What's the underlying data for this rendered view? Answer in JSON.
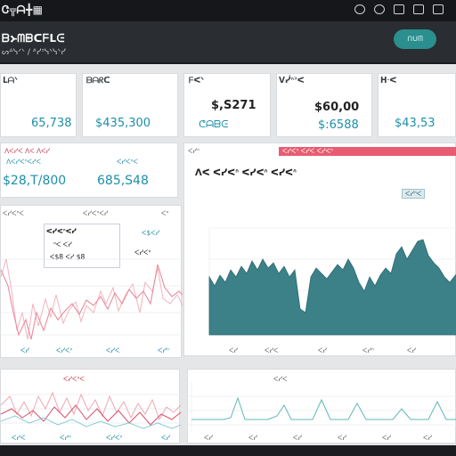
{
  "app": {
    "title": "Ꮳ╦ᗩ╋▦"
  },
  "header": {
    "title": "ᗷ᚛ᗰᗸᑕᖴᒪᕮ",
    "breadcrumb": "ᔕᐞᓭᐟᐠ / ᐥᓯᐣᓭᐠᓭᐠᓯ",
    "action_label": "ᑎᑌᗰ"
  },
  "kpis": [
    {
      "label": "ᒪᗩᐠ",
      "value": "65,738"
    },
    {
      "label": "ᗷᗩᖇᑕ",
      "value": "$435,300"
    },
    {
      "label": "ᖴᐸᐠ",
      "value": "$,S271",
      "sub": "ᕦᗩᗷᕮ"
    },
    {
      "label": "ᐯᓰᐢᐣᐸ",
      "value": "$60,00",
      "sub": "$:6588"
    },
    {
      "label": "ᕼᐧᐸ",
      "value": "$43,53"
    }
  ],
  "stats": {
    "header": "ᐱᐸᓯᐸ ᐱᐸ ᐱᐸᓯ",
    "row1_left": "ᐱᐸᓯᐸᐢᐸᓯᐸ",
    "row1_right": "ᐸᓯᐸᐢᐸ",
    "left_value": "$28,T/800",
    "right_value": "685,S48"
  },
  "left_chart": {
    "tab1": "ᐸᓯᐸᐢᐸ",
    "tab2": "ᐸᓯᐸᐢᐸᓯ",
    "tab3": "ᐸᐢ",
    "tooltip": [
      "ᐸᓯᐸᐢᐸᓯ",
      "ᐢᐸ ᐸᓯ",
      "ᐸ$8 ᐸᓯ $8"
    ],
    "legend_right": [
      "ᐸ$ᐸᓯ",
      "ᐸᓯᐸᐢ"
    ],
    "x_labels": [
      "ᐸᓯ",
      "ᐸᓯᐸᐢ",
      "ᐸᓯᐸ",
      "ᐸᓯᐢ"
    ]
  },
  "main_chart": {
    "title": "ᐱᐸ ᐸᓯᐸᐢ ᐸᓯᐸᐢ ᐸᓯᐸᐢ",
    "badge": "ᐸᓯᐢ",
    "filter": "ᐸᓯᐢᐸ",
    "red_tag": "ᐸᓯᐸᐢ ᐸᓯᐸ ᐸᓯᐸᐢ",
    "x_labels": [
      "ᐸᓯ",
      "ᐸᓯᐸ",
      "ᐸᓯ",
      "ᐸᓯᐢ",
      "ᐸᓯ"
    ]
  },
  "bottom_left": {
    "header": "ᐸᓯᐸᐢᐸ",
    "x_labels": [
      "ᐸᓯᐸ",
      "ᐸᓯᐢ",
      "ᐸᓯᐸᐢ",
      "ᐸᓯ"
    ]
  },
  "bottom_right": {
    "header": "ᐸᓯᐸ",
    "x_labels": [
      "ᐸᓯ",
      "ᐸᓯ",
      "ᐸᓯ",
      "ᐸᓯ",
      "ᐸᓯ",
      "ᐸᓯ"
    ]
  },
  "colors": {
    "teal": "#2f7f86",
    "red": "#e75c72",
    "blue": "#1e8fa8"
  },
  "icons": [
    "window-menu-icon",
    "help-icon",
    "settings-icon",
    "mail-icon",
    "close-icon"
  ]
}
